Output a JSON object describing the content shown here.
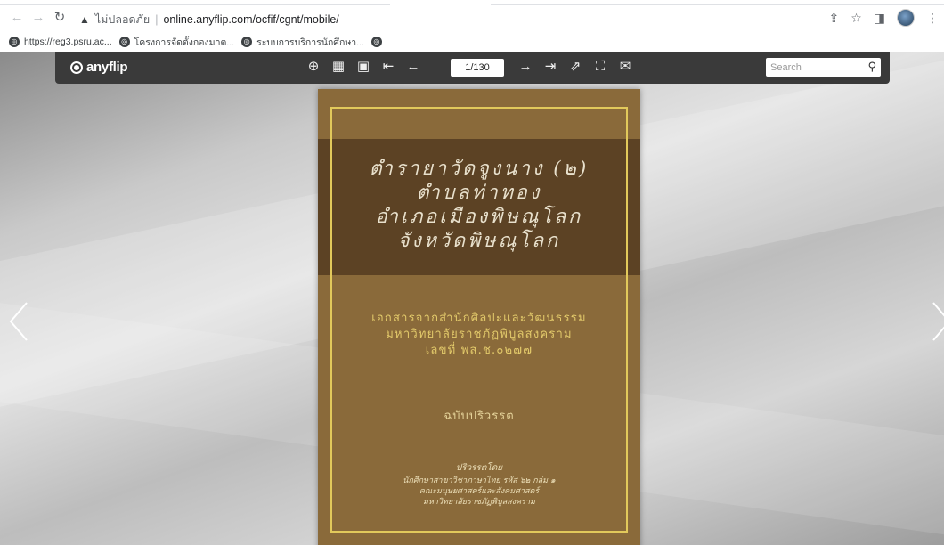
{
  "browser": {
    "insecure_label": "ไม่ปลอดภัย",
    "url": "online.anyflip.com/ocfif/cgnt/mobile/",
    "bookmarks": [
      {
        "label": "https://reg3.psru.ac..."
      },
      {
        "label": "โครงการจัดตั้งกองมาต..."
      },
      {
        "label": "ระบบการบริการนักศึกษา..."
      },
      {
        "label": ""
      }
    ]
  },
  "viewer": {
    "logo_text": "anyflip",
    "page_indicator": "1/130",
    "search_placeholder": "Search"
  },
  "cover": {
    "title_lines": [
      "ตำรายาวัดจูงนาง (๒)",
      "ตำบลท่าทอง",
      "อำเภอเมืองพิษณุโลก",
      "จังหวัดพิษณุโลก"
    ],
    "subtitle_lines": [
      "เอกสารจากสำนักศิลปะและวัฒนธรรม",
      "มหาวิทยาลัยราชภัฏพิบูลสงคราม",
      "เลขที่ พส.ช.๐๒๗๗"
    ],
    "edition": "ฉบับปริวรรต",
    "credit_lines": [
      "ปริวรรตโดย",
      "นักศึกษาสาขาวิชาภาษาไทย รหัส ๖๒ กลุ่ม ๑",
      "คณะมนุษยศาสตร์และสังคมศาสตร์",
      "มหาวิทยาลัยราชภัฏพิบูลสงคราม"
    ]
  },
  "colors": {
    "toolbar": "#3a3a3a",
    "cover": "#8a6a3a",
    "band": "#5c4224",
    "frame": "#e2c95b"
  }
}
